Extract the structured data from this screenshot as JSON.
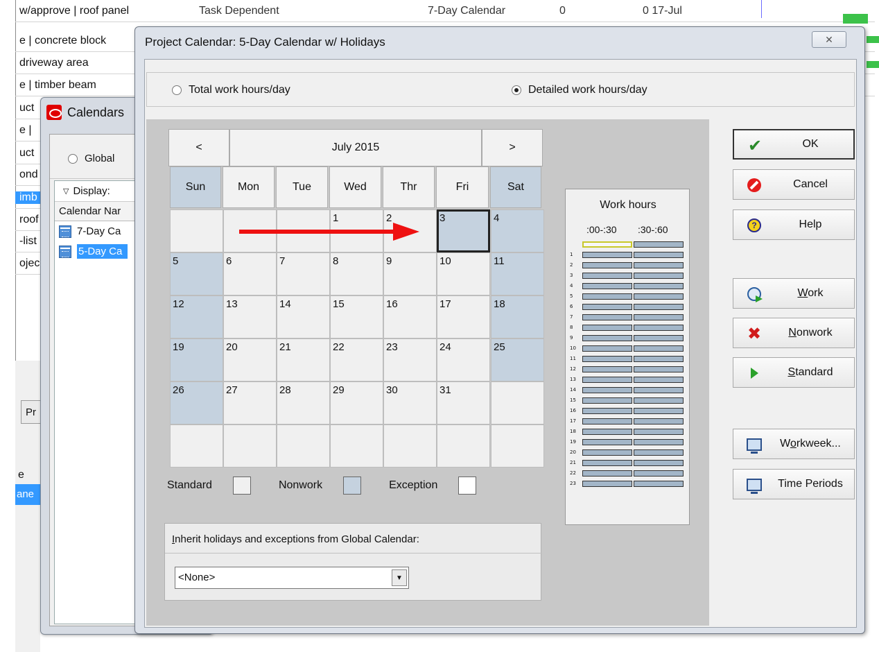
{
  "background": {
    "rows": [
      {
        "name": "w/approve | roof panel",
        "col2": "Task Dependent",
        "col3": "7-Day Calendar",
        "col4": "0",
        "col5": "0 17-Jul",
        "selected": false
      },
      {
        "name": "e | concrete block",
        "selected": false
      },
      {
        "name": "driveway area",
        "selected": false
      },
      {
        "name": "e | timber beam",
        "selected": false
      },
      {
        "name": "uct",
        "selected": false
      },
      {
        "name": "e | ",
        "selected": false
      },
      {
        "name": "uct",
        "selected": false
      },
      {
        "name": "ond",
        "selected": false
      },
      {
        "name": "imb",
        "selected": true
      },
      {
        "name": "roof",
        "selected": false
      },
      {
        "name": "-list",
        "selected": false
      },
      {
        "name": "ojec",
        "selected": false
      }
    ],
    "pr_button": "Pr",
    "e_label": "e",
    "ane_label": "ane"
  },
  "calendars_window": {
    "title": "Calendars",
    "radio_label": "Global",
    "display_label": "Display:",
    "column_header": "Calendar Nar",
    "items": [
      {
        "label": "7-Day Ca",
        "selected": false
      },
      {
        "label": "5-Day Ca",
        "selected": true
      }
    ]
  },
  "dialog": {
    "title": "Project Calendar: 5-Day Calendar w/ Holidays",
    "close_glyph": "ꟷ",
    "radio_total": "Total work hours/day",
    "radio_detailed": "Detailed work hours/day",
    "selected_radio": "detailed",
    "calendar": {
      "prev": "<",
      "next": ">",
      "month": "July 2015",
      "days": [
        "Sun",
        "Mon",
        "Tue",
        "Wed",
        "Thr",
        "Fri",
        "Sat"
      ],
      "weeks": [
        [
          "",
          "",
          "",
          "1",
          "2",
          "3",
          "4"
        ],
        [
          "5",
          "6",
          "7",
          "8",
          "9",
          "10",
          "11"
        ],
        [
          "12",
          "13",
          "14",
          "15",
          "16",
          "17",
          "18"
        ],
        [
          "19",
          "20",
          "21",
          "22",
          "23",
          "24",
          "25"
        ],
        [
          "26",
          "27",
          "28",
          "29",
          "30",
          "31",
          ""
        ],
        [
          "",
          "",
          "",
          "",
          "",
          "",
          ""
        ]
      ],
      "selected_day": "3"
    },
    "legend": {
      "standard": "Standard",
      "nonwork": "Nonwork",
      "exception": "Exception"
    },
    "inherit": {
      "label_prefix": "I",
      "label_rest": "nherit holidays and exceptions from Global Calendar:",
      "value": "<None>"
    },
    "work_hours": {
      "title": "Work hours",
      "col1": ":00-:30",
      "col2": ":30-:60",
      "hours": [
        "",
        "1",
        "2",
        "3",
        "4",
        "5",
        "6",
        "7",
        "8",
        "9",
        "10",
        "11",
        "12",
        "13",
        "14",
        "15",
        "16",
        "17",
        "18",
        "19",
        "20",
        "21",
        "22",
        "23"
      ]
    },
    "buttons": {
      "ok": "OK",
      "cancel": "Cancel",
      "help": "Help",
      "work_u": "W",
      "work_rest": "ork",
      "nonwork_u": "N",
      "nonwork_rest": "onwork",
      "standard_u": "S",
      "standard_rest": "tandard",
      "workweek_pre": "W",
      "workweek_u": "o",
      "workweek_rest": "rkweek...",
      "time_periods": "Time Periods"
    }
  },
  "colors": {
    "nonwork": "#c5d2df",
    "selection": "#3399ff",
    "arrow": "#ee1111"
  }
}
